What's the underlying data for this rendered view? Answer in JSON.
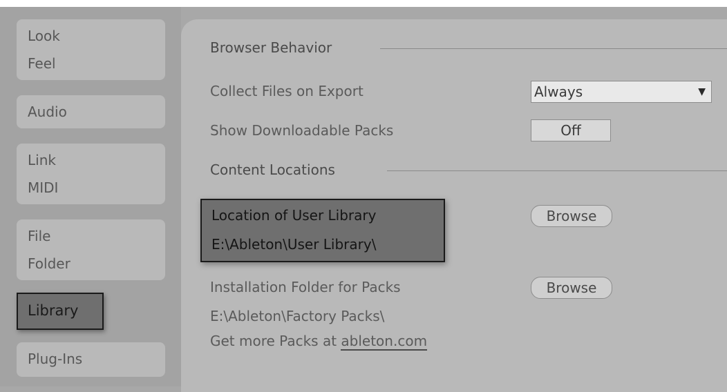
{
  "sidebar": {
    "tabs": [
      {
        "lines": [
          "Look",
          "Feel"
        ]
      },
      {
        "lines": [
          "Audio"
        ]
      },
      {
        "lines": [
          "Link",
          "MIDI"
        ]
      },
      {
        "lines": [
          "File",
          "Folder"
        ]
      },
      {
        "lines": [
          "Library"
        ],
        "active": true
      },
      {
        "lines": [
          "Plug-Ins"
        ]
      }
    ]
  },
  "browser_behavior": {
    "heading": "Browser Behavior",
    "collect_files_label": "Collect Files on Export",
    "collect_files_value": "Always",
    "show_packs_label": "Show Downloadable Packs",
    "show_packs_value": "Off"
  },
  "content_locations": {
    "heading": "Content Locations",
    "user_library_label": "Location of User Library",
    "user_library_path": "E:\\Ableton\\User Library\\",
    "browse_label": "Browse",
    "install_folder_label": "Installation Folder for Packs",
    "install_folder_path": "E:\\Ableton\\Factory Packs\\",
    "more_packs_prefix": "Get more Packs at ",
    "more_packs_link": "ableton.com"
  },
  "colors": {
    "background": "#a8a8a8",
    "panel": "#b9b9b9",
    "highlight": "#6f6f6f"
  }
}
